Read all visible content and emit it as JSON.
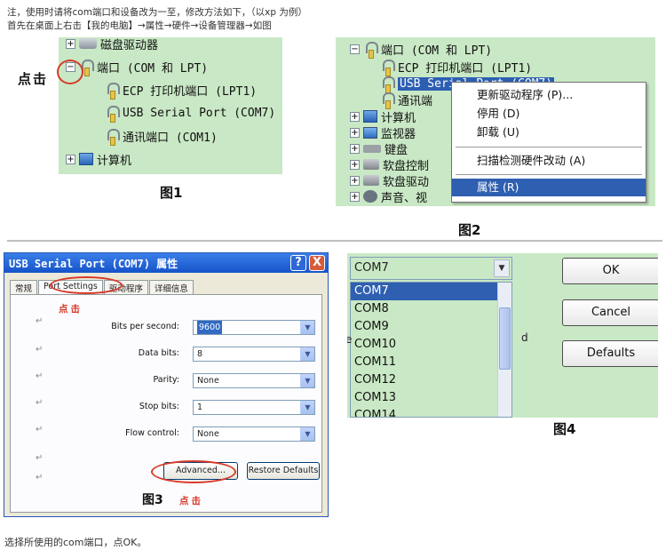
{
  "notes": {
    "line1": "注，使用时请将com端口和设备改为一至，修改方法如下，（以xp 为例）",
    "line2": "首先在桌面上右击【我的电脑】→属性→硬件→设备管理器→如图",
    "footer": "选择所使用的com端口，点OK。"
  },
  "fig1": {
    "label": "图1",
    "hint": "点击",
    "rows": [
      {
        "pm": "+",
        "icon": "drive",
        "text": "磁盘驱动器"
      },
      {
        "pm": "−",
        "icon": "port",
        "text": "端口 (COM 和 LPT)"
      },
      {
        "pm": "",
        "icon": "port",
        "text": "ECP 打印机端口 (LPT1)"
      },
      {
        "pm": "",
        "icon": "port",
        "text": "USB Serial Port (COM7)"
      },
      {
        "pm": "",
        "icon": "port",
        "text": "通讯端口 (COM1)"
      },
      {
        "pm": "+",
        "icon": "pc",
        "text": "计算机"
      }
    ]
  },
  "fig2": {
    "label": "图2",
    "rows": [
      {
        "pm": "−",
        "icon": "port",
        "text": "端口 (COM 和 LPT)"
      },
      {
        "pm": "",
        "icon": "port",
        "text": "ECP 打印机端口 (LPT1)"
      },
      {
        "pm": "",
        "icon": "port",
        "text": "USB Serial Port (COM7)"
      },
      {
        "pm": "",
        "icon": "port",
        "text": "通讯端"
      },
      {
        "pm": "+",
        "icon": "pc",
        "text": "计算机"
      },
      {
        "pm": "+",
        "icon": "mon",
        "text": "监视器"
      },
      {
        "pm": "+",
        "icon": "kbd",
        "text": "键盘"
      },
      {
        "pm": "+",
        "icon": "disk",
        "text": "软盘控制"
      },
      {
        "pm": "+",
        "icon": "disk",
        "text": "软盘驱动"
      },
      {
        "pm": "+",
        "icon": "sound",
        "text": "声音、视"
      }
    ],
    "menu": [
      "更新驱动程序 (P)...",
      "停用 (D)",
      "卸载 (U)",
      "扫描检测硬件改动 (A)",
      "属性 (R)"
    ]
  },
  "fig3": {
    "label": "图3",
    "label_hint": "点击",
    "title": "USB Serial Port (COM7) 属性",
    "help": "?",
    "close": "X",
    "tabs": [
      "常规",
      "Port Settings",
      "驱动程序",
      "详细信息"
    ],
    "hint": "点击",
    "fields": [
      {
        "label": "Bits per second:",
        "value": "9600"
      },
      {
        "label": "Data bits:",
        "value": "8"
      },
      {
        "label": "Parity:",
        "value": "None"
      },
      {
        "label": "Stop bits:",
        "value": "1"
      },
      {
        "label": "Flow control:",
        "value": "None"
      }
    ],
    "advanced": "Advanced...",
    "restore": "Restore Defaults",
    "ret": "↵"
  },
  "fig4": {
    "label": "图4",
    "selected": "COM7",
    "items": [
      "COM7",
      "COM8",
      "COM9",
      "COM10",
      "COM11",
      "COM12",
      "COM13",
      "COM14"
    ],
    "ok": "OK",
    "cancel": "Cancel",
    "defaults": "Defaults",
    "frag_e": "e",
    "frag_d": "d"
  },
  "colors": {
    "tree_bg": "#c9e8c5",
    "selection": "#2f5fb0",
    "red": "#d83a2a",
    "xp_title": "#1553c9"
  }
}
